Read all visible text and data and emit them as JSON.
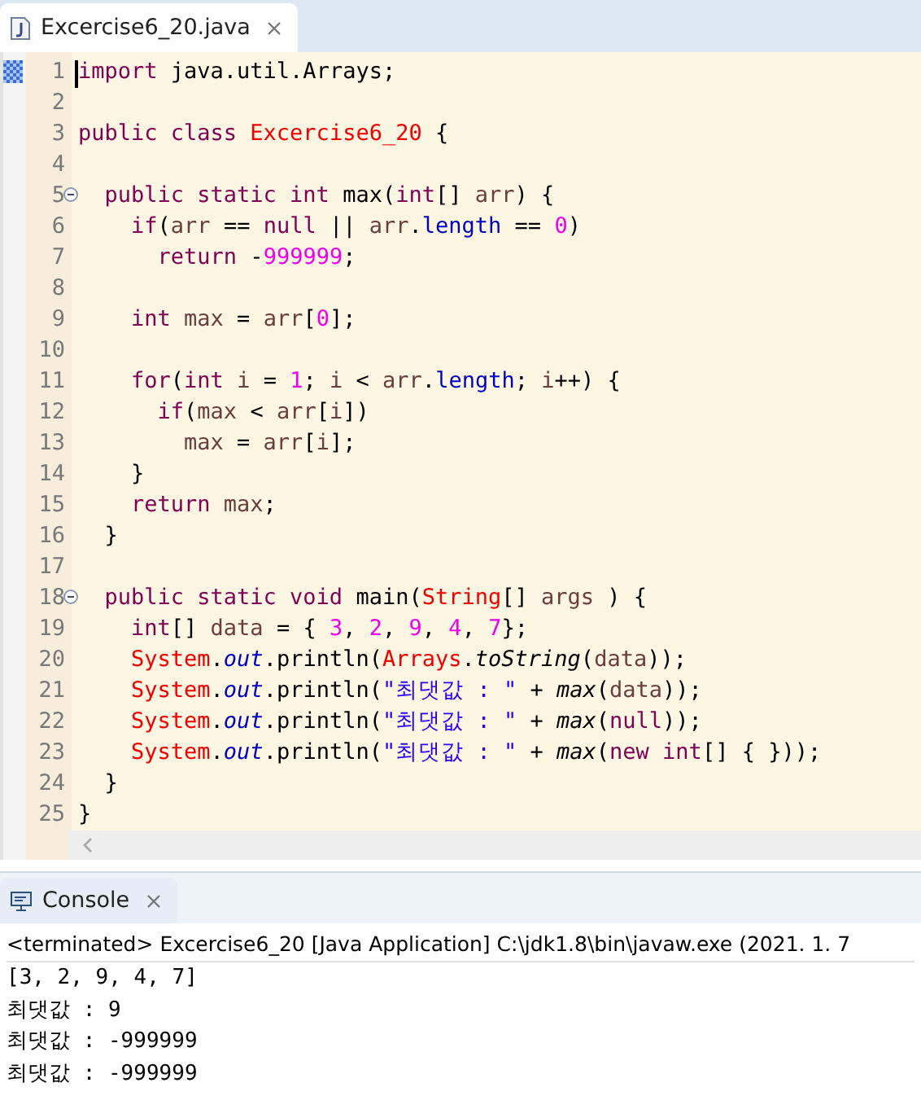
{
  "editor": {
    "tab": {
      "label": "Excercise6_20.java",
      "selected": true
    },
    "lines": [
      {
        "number": "1",
        "cursor": true,
        "tokens": [
          {
            "kind": "kw",
            "text": "import"
          },
          {
            "kind": "plain",
            "text": " java.util.Arrays;"
          }
        ]
      },
      {
        "number": "2"
      },
      {
        "number": "3",
        "tokens": [
          {
            "kind": "kw",
            "text": "public class "
          },
          {
            "kind": "cls",
            "text": "Excercise6_20"
          },
          {
            "kind": "plain",
            "text": " {"
          }
        ]
      },
      {
        "number": "4"
      },
      {
        "number": "5",
        "fold": true,
        "tokens": [
          {
            "kind": "kw",
            "text": "  public static int"
          },
          {
            "kind": "plain",
            "text": " max("
          },
          {
            "kind": "kw",
            "text": "int"
          },
          {
            "kind": "plain",
            "text": "[] "
          },
          {
            "kind": "var",
            "text": "arr"
          },
          {
            "kind": "plain",
            "text": ") {"
          }
        ]
      },
      {
        "number": "6",
        "tokens": [
          {
            "kind": "kw",
            "text": "    if"
          },
          {
            "kind": "plain",
            "text": "("
          },
          {
            "kind": "var",
            "text": "arr"
          },
          {
            "kind": "plain",
            "text": " == "
          },
          {
            "kind": "kw",
            "text": "null"
          },
          {
            "kind": "plain",
            "text": " || "
          },
          {
            "kind": "var",
            "text": "arr"
          },
          {
            "kind": "plain",
            "text": "."
          },
          {
            "kind": "field",
            "text": "length"
          },
          {
            "kind": "plain",
            "text": " == "
          },
          {
            "kind": "num",
            "text": "0"
          },
          {
            "kind": "plain",
            "text": ")"
          }
        ]
      },
      {
        "number": "7",
        "tokens": [
          {
            "kind": "kw",
            "text": "      return"
          },
          {
            "kind": "plain",
            "text": " -"
          },
          {
            "kind": "num",
            "text": "999999"
          },
          {
            "kind": "plain",
            "text": ";"
          }
        ]
      },
      {
        "number": "8"
      },
      {
        "number": "9",
        "tokens": [
          {
            "kind": "kw",
            "text": "    int "
          },
          {
            "kind": "var",
            "text": "max"
          },
          {
            "kind": "plain",
            "text": " = "
          },
          {
            "kind": "var",
            "text": "arr"
          },
          {
            "kind": "plain",
            "text": "["
          },
          {
            "kind": "num",
            "text": "0"
          },
          {
            "kind": "plain",
            "text": "];"
          }
        ]
      },
      {
        "number": "10"
      },
      {
        "number": "11",
        "tokens": [
          {
            "kind": "kw",
            "text": "    for"
          },
          {
            "kind": "plain",
            "text": "("
          },
          {
            "kind": "kw",
            "text": "int "
          },
          {
            "kind": "var",
            "text": "i"
          },
          {
            "kind": "plain",
            "text": " = "
          },
          {
            "kind": "num",
            "text": "1"
          },
          {
            "kind": "plain",
            "text": "; "
          },
          {
            "kind": "var",
            "text": "i"
          },
          {
            "kind": "plain",
            "text": " < "
          },
          {
            "kind": "var",
            "text": "arr"
          },
          {
            "kind": "plain",
            "text": "."
          },
          {
            "kind": "field",
            "text": "length"
          },
          {
            "kind": "plain",
            "text": "; "
          },
          {
            "kind": "var",
            "text": "i"
          },
          {
            "kind": "plain",
            "text": "++) {"
          }
        ]
      },
      {
        "number": "12",
        "tokens": [
          {
            "kind": "kw",
            "text": "      if"
          },
          {
            "kind": "plain",
            "text": "("
          },
          {
            "kind": "var",
            "text": "max"
          },
          {
            "kind": "plain",
            "text": " < "
          },
          {
            "kind": "var",
            "text": "arr"
          },
          {
            "kind": "plain",
            "text": "["
          },
          {
            "kind": "var",
            "text": "i"
          },
          {
            "kind": "plain",
            "text": "])"
          }
        ]
      },
      {
        "number": "13",
        "tokens": [
          {
            "kind": "var",
            "text": "        max"
          },
          {
            "kind": "plain",
            "text": " = "
          },
          {
            "kind": "var",
            "text": "arr"
          },
          {
            "kind": "plain",
            "text": "["
          },
          {
            "kind": "var",
            "text": "i"
          },
          {
            "kind": "plain",
            "text": "];"
          }
        ]
      },
      {
        "number": "14",
        "tokens": [
          {
            "kind": "plain",
            "text": "    }"
          }
        ]
      },
      {
        "number": "15",
        "tokens": [
          {
            "kind": "kw",
            "text": "    return "
          },
          {
            "kind": "var",
            "text": "max"
          },
          {
            "kind": "plain",
            "text": ";"
          }
        ]
      },
      {
        "number": "16",
        "tokens": [
          {
            "kind": "plain",
            "text": "  }"
          }
        ]
      },
      {
        "number": "17"
      },
      {
        "number": "18",
        "fold": true,
        "tokens": [
          {
            "kind": "kw",
            "text": "  public static void"
          },
          {
            "kind": "plain",
            "text": " main("
          },
          {
            "kind": "cls",
            "text": "String"
          },
          {
            "kind": "plain",
            "text": "[] "
          },
          {
            "kind": "var",
            "text": "args"
          },
          {
            "kind": "plain",
            "text": " ) {"
          }
        ]
      },
      {
        "number": "19",
        "tokens": [
          {
            "kind": "kw",
            "text": "    int"
          },
          {
            "kind": "plain",
            "text": "[] "
          },
          {
            "kind": "var",
            "text": "data"
          },
          {
            "kind": "plain",
            "text": " = { "
          },
          {
            "kind": "num",
            "text": "3"
          },
          {
            "kind": "plain",
            "text": ", "
          },
          {
            "kind": "num",
            "text": "2"
          },
          {
            "kind": "plain",
            "text": ", "
          },
          {
            "kind": "num",
            "text": "9"
          },
          {
            "kind": "plain",
            "text": ", "
          },
          {
            "kind": "num",
            "text": "4"
          },
          {
            "kind": "plain",
            "text": ", "
          },
          {
            "kind": "num",
            "text": "7"
          },
          {
            "kind": "plain",
            "text": "};"
          }
        ]
      },
      {
        "number": "20",
        "tokens": [
          {
            "kind": "cls",
            "text": "    System"
          },
          {
            "kind": "plain",
            "text": "."
          },
          {
            "kind": "sfield",
            "text": "out"
          },
          {
            "kind": "plain",
            "text": ".println("
          },
          {
            "kind": "cls",
            "text": "Arrays"
          },
          {
            "kind": "plain",
            "text": "."
          },
          {
            "kind": "smethod",
            "text": "toString"
          },
          {
            "kind": "plain",
            "text": "("
          },
          {
            "kind": "var",
            "text": "data"
          },
          {
            "kind": "plain",
            "text": "));"
          }
        ]
      },
      {
        "number": "21",
        "tokens": [
          {
            "kind": "cls",
            "text": "    System"
          },
          {
            "kind": "plain",
            "text": "."
          },
          {
            "kind": "sfield",
            "text": "out"
          },
          {
            "kind": "plain",
            "text": ".println("
          },
          {
            "kind": "str",
            "text": "\"최댓값 : \""
          },
          {
            "kind": "plain",
            "text": " + "
          },
          {
            "kind": "smethod",
            "text": "max"
          },
          {
            "kind": "plain",
            "text": "("
          },
          {
            "kind": "var",
            "text": "data"
          },
          {
            "kind": "plain",
            "text": "));"
          }
        ]
      },
      {
        "number": "22",
        "tokens": [
          {
            "kind": "cls",
            "text": "    System"
          },
          {
            "kind": "plain",
            "text": "."
          },
          {
            "kind": "sfield",
            "text": "out"
          },
          {
            "kind": "plain",
            "text": ".println("
          },
          {
            "kind": "str",
            "text": "\"최댓값 : \""
          },
          {
            "kind": "plain",
            "text": " + "
          },
          {
            "kind": "smethod",
            "text": "max"
          },
          {
            "kind": "plain",
            "text": "("
          },
          {
            "kind": "kw",
            "text": "null"
          },
          {
            "kind": "plain",
            "text": "));"
          }
        ]
      },
      {
        "number": "23",
        "tokens": [
          {
            "kind": "cls",
            "text": "    System"
          },
          {
            "kind": "plain",
            "text": "."
          },
          {
            "kind": "sfield",
            "text": "out"
          },
          {
            "kind": "plain",
            "text": ".println("
          },
          {
            "kind": "str",
            "text": "\"최댓값 : \""
          },
          {
            "kind": "plain",
            "text": " + "
          },
          {
            "kind": "smethod",
            "text": "max"
          },
          {
            "kind": "plain",
            "text": "("
          },
          {
            "kind": "kw",
            "text": "new int"
          },
          {
            "kind": "plain",
            "text": "[] { }));"
          }
        ]
      },
      {
        "number": "24",
        "tokens": [
          {
            "kind": "plain",
            "text": "  }"
          }
        ]
      },
      {
        "number": "25",
        "tokens": [
          {
            "kind": "plain",
            "text": "}"
          }
        ]
      }
    ]
  },
  "console": {
    "tab": {
      "label": "Console",
      "selected": false
    },
    "header": "<terminated> Excercise6_20 [Java Application] C:\\jdk1.8\\bin\\javaw.exe (2021. 1. 7",
    "output": [
      "[3, 2, 9, 4, 7]",
      "최댓값 : 9",
      "최댓값 : -999999",
      "최댓값 : -999999"
    ]
  }
}
